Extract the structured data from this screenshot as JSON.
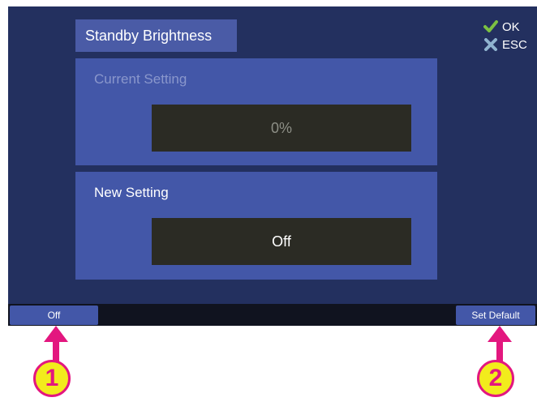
{
  "title": "Standby Brightness",
  "key_legend": {
    "ok_label": "OK",
    "esc_label": "ESC",
    "ok_icon": "check-icon",
    "esc_icon": "cross-icon"
  },
  "current_setting": {
    "label": "Current Setting",
    "value": "0%"
  },
  "new_setting": {
    "label": "New Setting",
    "value": "Off"
  },
  "softkeys": {
    "left_label": "Off",
    "right_label": "Set Default"
  },
  "callouts": {
    "left_number": "1",
    "right_number": "2"
  },
  "colors": {
    "screen_bg": "#23305f",
    "panel_bg": "#4357a8",
    "value_box_bg": "#2b2b24",
    "check_green": "#7cc142",
    "cross_blue": "#8fb3cf",
    "callout_magenta": "#e3177f",
    "callout_yellow": "#f2ec1c"
  }
}
